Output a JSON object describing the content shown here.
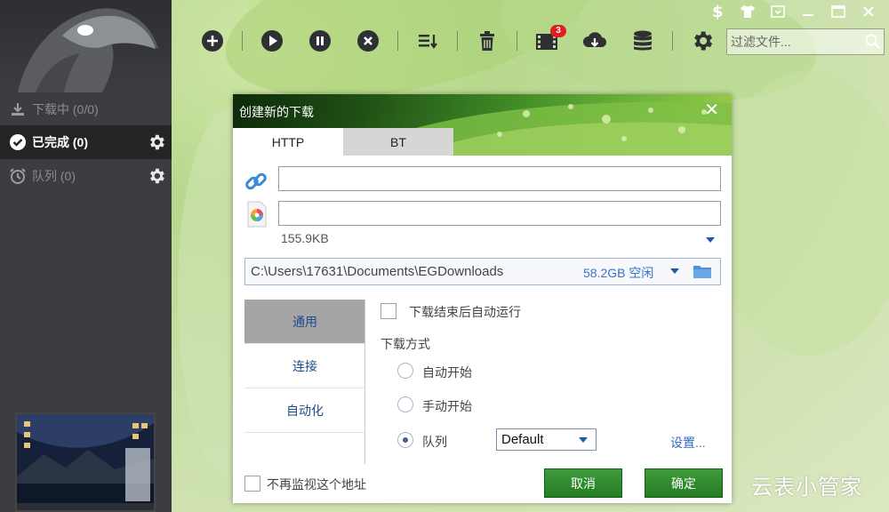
{
  "sidebar": {
    "items": [
      {
        "label": "下载中 (0/0)"
      },
      {
        "label": "已完成 (0)"
      },
      {
        "label": "队列 (0)"
      }
    ]
  },
  "toolbar": {
    "badge_count": "3",
    "search_placeholder": "过滤文件..."
  },
  "dialog": {
    "title": "创建新的下载",
    "tabs": [
      "HTTP",
      "BT"
    ],
    "url_value": "",
    "name_value": "",
    "file_size": "155.9KB",
    "save_path": "C:\\Users\\17631\\Documents\\EGDownloads",
    "free_space": "58.2GB 空闲",
    "option_tabs": [
      "通用",
      "连接",
      "自动化"
    ],
    "auto_run_label": "下载结束后自动运行",
    "download_mode_label": "下载方式",
    "mode_options": [
      "自动开始",
      "手动开始",
      "队列"
    ],
    "queue_value": "Default",
    "settings_link": "设置...",
    "no_monitor_label": "不再监视这个地址",
    "cancel_label": "取消",
    "ok_label": "确定"
  },
  "watermark": "云表小管家",
  "colors": {
    "sidebar_bg": "#3b3d40",
    "button_green": "#2e8b2c",
    "link_blue": "#2f6db8"
  }
}
